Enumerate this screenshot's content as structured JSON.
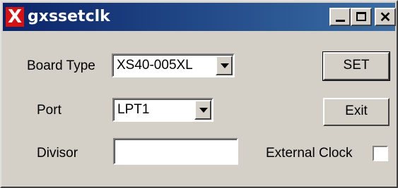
{
  "window": {
    "title": "gxssetclk",
    "icon": "x-logo-icon",
    "icon_color": "#d81010",
    "title_gradient": [
      "#0a246a",
      "#3a6ea5"
    ]
  },
  "titlebar_buttons": {
    "minimize": "minimize-icon",
    "maximize": "maximize-icon",
    "close": "close-icon"
  },
  "form": {
    "board_type": {
      "label": "Board Type",
      "value": "XS40-005XL"
    },
    "port": {
      "label": "Port",
      "value": "LPT1"
    },
    "divisor": {
      "label": "Divisor",
      "value": ""
    },
    "external_clock": {
      "label": "External Clock",
      "checked": false
    }
  },
  "buttons": {
    "set": "SET",
    "exit": "Exit"
  }
}
